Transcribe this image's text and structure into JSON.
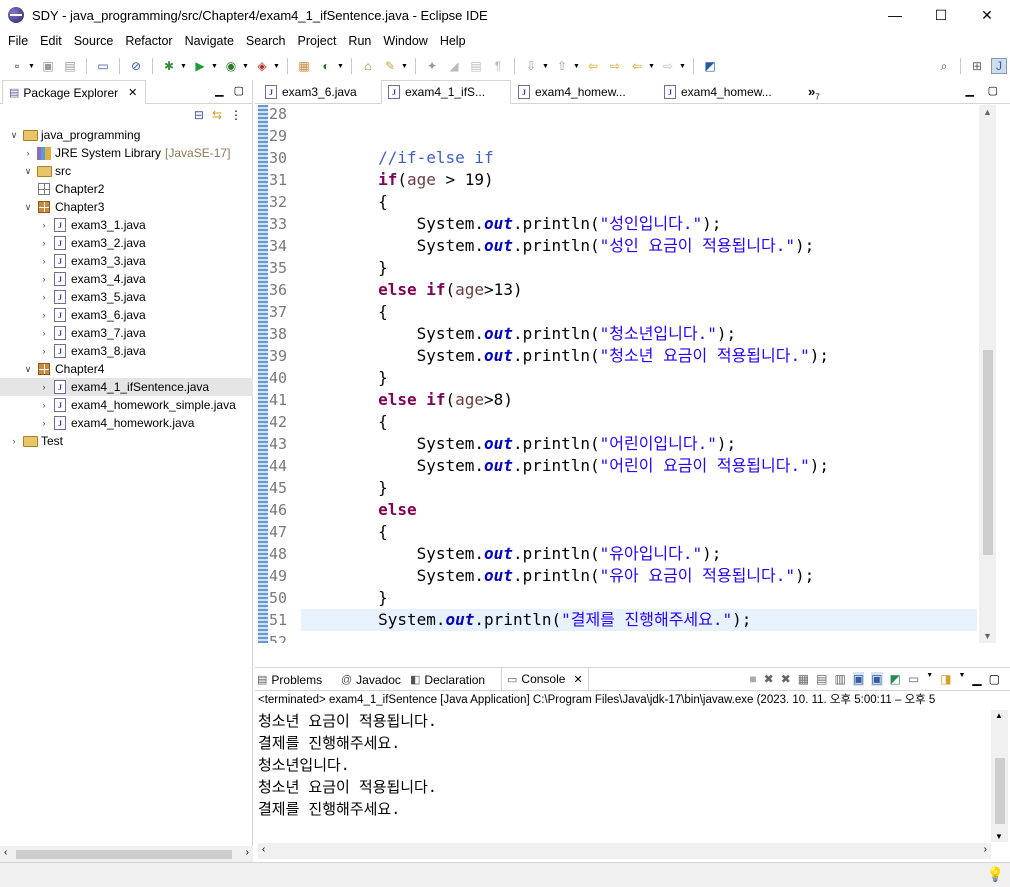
{
  "window": {
    "title": "SDY - java_programming/src/Chapter4/exam4_1_ifSentence.java - Eclipse IDE",
    "min_glyph": "—",
    "max_glyph": "☐",
    "close_glyph": "✕"
  },
  "menu": [
    "File",
    "Edit",
    "Source",
    "Refactor",
    "Navigate",
    "Search",
    "Project",
    "Run",
    "Window",
    "Help"
  ],
  "package_explorer": {
    "tab_label": "Package Explorer",
    "tree": [
      {
        "label": "java_programming",
        "indent": 0,
        "arrow": "⌵",
        "icon": "project-icon"
      },
      {
        "label": "JRE System Library",
        "extra": "[JavaSE-17]",
        "indent": 1,
        "arrow": "›",
        "icon": "library-icon"
      },
      {
        "label": "src",
        "indent": 1,
        "arrow": "⌵",
        "icon": "source-folder-icon"
      },
      {
        "label": "Chapter2",
        "indent": 2,
        "arrow": "",
        "icon": "empty-package-icon"
      },
      {
        "label": "Chapter3",
        "indent": 2,
        "arrow": "⌵",
        "icon": "package-icon"
      },
      {
        "label": "exam3_1.java",
        "indent": 3,
        "arrow": "›",
        "icon": "java-file-icon"
      },
      {
        "label": "exam3_2.java",
        "indent": 3,
        "arrow": "›",
        "icon": "java-file-icon"
      },
      {
        "label": "exam3_3.java",
        "indent": 3,
        "arrow": "›",
        "icon": "java-file-icon"
      },
      {
        "label": "exam3_4.java",
        "indent": 3,
        "arrow": "›",
        "icon": "java-file-icon"
      },
      {
        "label": "exam3_5.java",
        "indent": 3,
        "arrow": "›",
        "icon": "java-file-icon"
      },
      {
        "label": "exam3_6.java",
        "indent": 3,
        "arrow": "›",
        "icon": "java-file-icon"
      },
      {
        "label": "exam3_7.java",
        "indent": 3,
        "arrow": "›",
        "icon": "java-file-icon"
      },
      {
        "label": "exam3_8.java",
        "indent": 3,
        "arrow": "›",
        "icon": "java-file-icon"
      },
      {
        "label": "Chapter4",
        "indent": 2,
        "arrow": "⌵",
        "icon": "package-icon"
      },
      {
        "label": "exam4_1_ifSentence.java",
        "indent": 3,
        "arrow": "›",
        "icon": "java-file-icon",
        "selected": true
      },
      {
        "label": "exam4_homework_simple.java",
        "indent": 3,
        "arrow": "›",
        "icon": "java-file-icon"
      },
      {
        "label": "exam4_homework.java",
        "indent": 3,
        "arrow": "›",
        "icon": "java-file-icon"
      },
      {
        "label": "Test",
        "indent": 0,
        "arrow": "›",
        "icon": "project-icon"
      }
    ]
  },
  "editor": {
    "tabs": [
      {
        "label": "exam3_6.java",
        "active": false
      },
      {
        "label": "exam4_1_ifS...",
        "active": true
      },
      {
        "label": "exam4_homew...",
        "active": false
      },
      {
        "label": "exam4_homew...",
        "active": false
      }
    ],
    "overflow_label": "»",
    "overflow_count": "7",
    "lines": [
      {
        "n": "28",
        "tokens": []
      },
      {
        "n": "29",
        "tokens": []
      },
      {
        "n": "30",
        "tokens": [
          {
            "t": "        ",
            "c": ""
          },
          {
            "t": "//if-else if",
            "c": "cm"
          }
        ]
      },
      {
        "n": "31",
        "tokens": [
          {
            "t": "        ",
            "c": ""
          },
          {
            "t": "if",
            "c": "kw"
          },
          {
            "t": "(",
            "c": ""
          },
          {
            "t": "age",
            "c": "vr"
          },
          {
            "t": " > 19)",
            "c": ""
          }
        ]
      },
      {
        "n": "32",
        "tokens": [
          {
            "t": "        {",
            "c": ""
          }
        ]
      },
      {
        "n": "33",
        "tokens": [
          {
            "t": "            System.",
            "c": ""
          },
          {
            "t": "out",
            "c": "fd"
          },
          {
            "t": ".println(",
            "c": ""
          },
          {
            "t": "\"성인입니다.\"",
            "c": "st"
          },
          {
            "t": ");",
            "c": ""
          }
        ]
      },
      {
        "n": "34",
        "tokens": [
          {
            "t": "            System.",
            "c": ""
          },
          {
            "t": "out",
            "c": "fd"
          },
          {
            "t": ".println(",
            "c": ""
          },
          {
            "t": "\"성인 요금이 적용됩니다.\"",
            "c": "st"
          },
          {
            "t": ");",
            "c": ""
          }
        ]
      },
      {
        "n": "35",
        "tokens": [
          {
            "t": "        }",
            "c": ""
          }
        ]
      },
      {
        "n": "36",
        "tokens": [
          {
            "t": "        ",
            "c": ""
          },
          {
            "t": "else if",
            "c": "kw"
          },
          {
            "t": "(",
            "c": ""
          },
          {
            "t": "age",
            "c": "vr"
          },
          {
            "t": ">13)",
            "c": ""
          }
        ]
      },
      {
        "n": "37",
        "tokens": [
          {
            "t": "        {",
            "c": ""
          }
        ]
      },
      {
        "n": "38",
        "tokens": [
          {
            "t": "            System.",
            "c": ""
          },
          {
            "t": "out",
            "c": "fd"
          },
          {
            "t": ".println(",
            "c": ""
          },
          {
            "t": "\"청소년입니다.\"",
            "c": "st"
          },
          {
            "t": ");",
            "c": ""
          }
        ]
      },
      {
        "n": "39",
        "tokens": [
          {
            "t": "            System.",
            "c": ""
          },
          {
            "t": "out",
            "c": "fd"
          },
          {
            "t": ".println(",
            "c": ""
          },
          {
            "t": "\"청소년 요금이 적용됩니다.\"",
            "c": "st"
          },
          {
            "t": ");",
            "c": ""
          }
        ]
      },
      {
        "n": "40",
        "tokens": [
          {
            "t": "        }",
            "c": ""
          }
        ]
      },
      {
        "n": "41",
        "tokens": [
          {
            "t": "        ",
            "c": ""
          },
          {
            "t": "else if",
            "c": "kw"
          },
          {
            "t": "(",
            "c": ""
          },
          {
            "t": "age",
            "c": "vr"
          },
          {
            "t": ">8)",
            "c": ""
          }
        ]
      },
      {
        "n": "42",
        "tokens": [
          {
            "t": "        {",
            "c": ""
          }
        ]
      },
      {
        "n": "43",
        "tokens": [
          {
            "t": "            System.",
            "c": ""
          },
          {
            "t": "out",
            "c": "fd"
          },
          {
            "t": ".println(",
            "c": ""
          },
          {
            "t": "\"어린이입니다.\"",
            "c": "st"
          },
          {
            "t": ");",
            "c": ""
          }
        ]
      },
      {
        "n": "44",
        "tokens": [
          {
            "t": "            System.",
            "c": ""
          },
          {
            "t": "out",
            "c": "fd"
          },
          {
            "t": ".println(",
            "c": ""
          },
          {
            "t": "\"어린이 요금이 적용됩니다.\"",
            "c": "st"
          },
          {
            "t": ");",
            "c": ""
          }
        ]
      },
      {
        "n": "45",
        "tokens": [
          {
            "t": "        }",
            "c": ""
          }
        ]
      },
      {
        "n": "46",
        "tokens": [
          {
            "t": "        ",
            "c": ""
          },
          {
            "t": "else",
            "c": "kw"
          }
        ]
      },
      {
        "n": "47",
        "tokens": [
          {
            "t": "        {",
            "c": ""
          }
        ]
      },
      {
        "n": "48",
        "tokens": [
          {
            "t": "            System.",
            "c": ""
          },
          {
            "t": "out",
            "c": "fd"
          },
          {
            "t": ".println(",
            "c": ""
          },
          {
            "t": "\"유아입니다.\"",
            "c": "st"
          },
          {
            "t": ");",
            "c": ""
          }
        ]
      },
      {
        "n": "49",
        "tokens": [
          {
            "t": "            System.",
            "c": ""
          },
          {
            "t": "out",
            "c": "fd"
          },
          {
            "t": ".println(",
            "c": ""
          },
          {
            "t": "\"유아 요금이 적용됩니다.\"",
            "c": "st"
          },
          {
            "t": ");",
            "c": ""
          }
        ]
      },
      {
        "n": "50",
        "tokens": [
          {
            "t": "        }",
            "c": ""
          }
        ]
      },
      {
        "n": "51",
        "current": true,
        "tokens": [
          {
            "t": "        System.",
            "c": ""
          },
          {
            "t": "out",
            "c": "fd"
          },
          {
            "t": ".println(",
            "c": ""
          },
          {
            "t": "\"결제를 진행해주세요.\"",
            "c": "st"
          },
          {
            "t": ");",
            "c": ""
          }
        ]
      },
      {
        "n": "52",
        "tokens": []
      }
    ]
  },
  "bottom_panel": {
    "tabs": [
      {
        "label": "Problems",
        "icon": "problems-icon",
        "active": false
      },
      {
        "label": "Javadoc",
        "icon": "javadoc-icon",
        "active": false
      },
      {
        "label": "Declaration",
        "icon": "declaration-icon",
        "active": false
      },
      {
        "label": "Console",
        "icon": "console-icon",
        "active": true
      }
    ],
    "status": "<terminated> exam4_1_ifSentence [Java Application] C:\\Program Files\\Java\\jdk-17\\bin\\javaw.exe  (2023. 10. 11. 오후 5:00:11 – 오후 5",
    "output": [
      "청소년 요금이 적용됩니다.",
      "결제를 진행해주세요.",
      "청소년입니다.",
      "청소년 요금이 적용됩니다.",
      "결제를 진행해주세요."
    ]
  },
  "colors": {
    "keyword": "#7f0055",
    "comment": "#3f5fbf",
    "string": "#2a00ff",
    "field": "#0000c0",
    "current_line": "#e8f2fe"
  }
}
